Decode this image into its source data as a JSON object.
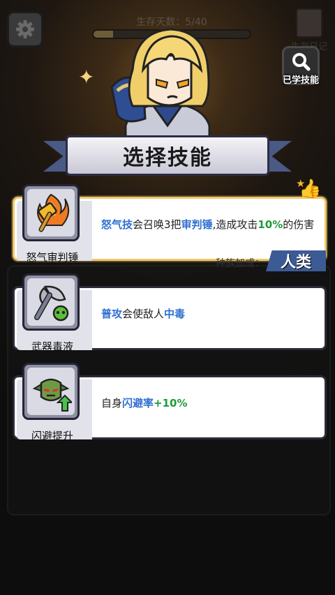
{
  "header": {
    "days_text": "生存天数：5/40",
    "days_progress": 0.125,
    "diary_label": "生存日记",
    "learned_skills_label": "已学技能"
  },
  "title": "选择技能",
  "skills": [
    {
      "name": "怒气审判锤",
      "icon": "flaming-hammer-icon",
      "desc_parts": [
        {
          "text": "怒气技",
          "style": "kw"
        },
        {
          "text": "会召唤3把",
          "style": "plain"
        },
        {
          "text": "审判锤",
          "style": "kw"
        },
        {
          "text": ",造成攻击",
          "style": "plain"
        },
        {
          "text": "10%",
          "style": "num"
        },
        {
          "text": "的伤害",
          "style": "plain"
        }
      ],
      "bonus_label": "种族加成：",
      "race": "人类",
      "selected": true
    },
    {
      "name": "武器毒液",
      "icon": "poison-axe-icon",
      "desc_parts": [
        {
          "text": "普攻",
          "style": "kw"
        },
        {
          "text": "会使敌人",
          "style": "plain"
        },
        {
          "text": "中毒",
          "style": "kw"
        }
      ],
      "selected": false
    },
    {
      "name": "闪避提升",
      "icon": "goblin-dodge-icon",
      "desc_parts": [
        {
          "text": "自身",
          "style": "plain"
        },
        {
          "text": "闪避率",
          "style": "kw"
        },
        {
          "text": "+10%",
          "style": "num"
        }
      ],
      "selected": false
    }
  ],
  "colors": {
    "keyword": "#2f6fd1",
    "number": "#1f9a3a",
    "race_tag": "#3c5a94"
  }
}
